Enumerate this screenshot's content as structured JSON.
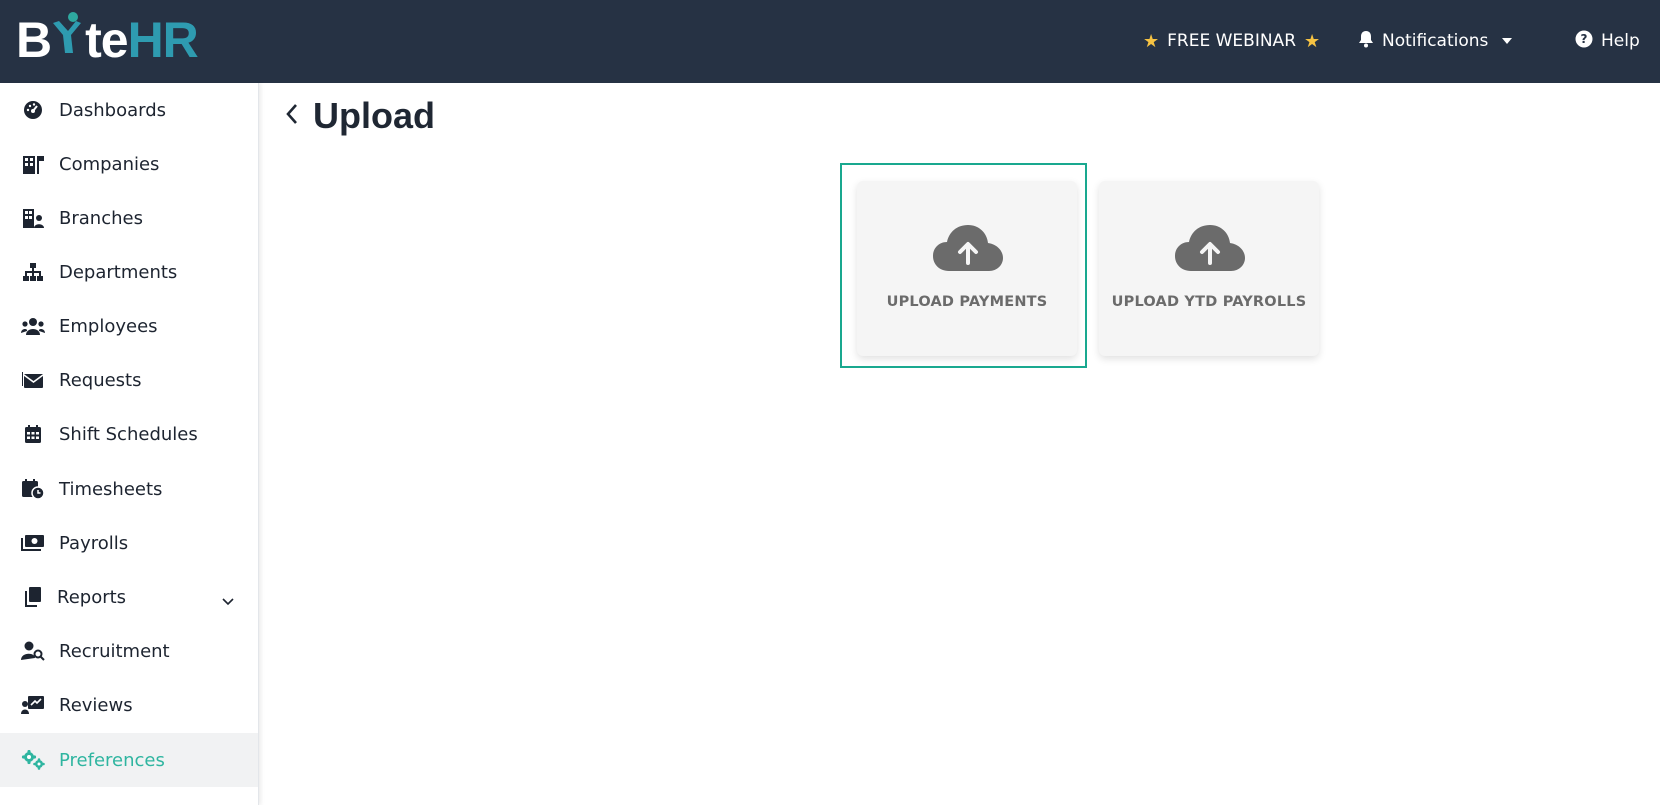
{
  "brand": {
    "logo_b": "B",
    "logo_te": "te",
    "logo_hr": "HR",
    "accent": "#2fb5a0",
    "topbar_color": "#263244"
  },
  "topbar": {
    "webinar": "FREE WEBINAR",
    "notifications": "Notifications",
    "help": "Help"
  },
  "sidebar": {
    "items": [
      {
        "label": "Dashboards",
        "icon": "dashboard-icon"
      },
      {
        "label": "Companies",
        "icon": "building-icon"
      },
      {
        "label": "Branches",
        "icon": "branch-icon"
      },
      {
        "label": "Departments",
        "icon": "sitemap-icon"
      },
      {
        "label": "Employees",
        "icon": "users-icon"
      },
      {
        "label": "Requests",
        "icon": "envelope-icon"
      },
      {
        "label": "Shift Schedules",
        "icon": "calendar-icon"
      },
      {
        "label": "Timesheets",
        "icon": "calendar-clock-icon"
      },
      {
        "label": "Payrolls",
        "icon": "money-icon"
      },
      {
        "label": "Reports",
        "icon": "copy-icon"
      },
      {
        "label": "Recruitment",
        "icon": "user-search-icon"
      },
      {
        "label": "Reviews",
        "icon": "chart-board-icon"
      },
      {
        "label": "Preferences",
        "icon": "gears-icon",
        "active": true
      }
    ]
  },
  "page": {
    "title": "Upload",
    "cards": [
      {
        "label": "UPLOAD PAYMENTS",
        "icon": "cloud-upload-icon",
        "selected": true
      },
      {
        "label": "UPLOAD YTD PAYROLLS",
        "icon": "cloud-upload-icon"
      }
    ]
  }
}
